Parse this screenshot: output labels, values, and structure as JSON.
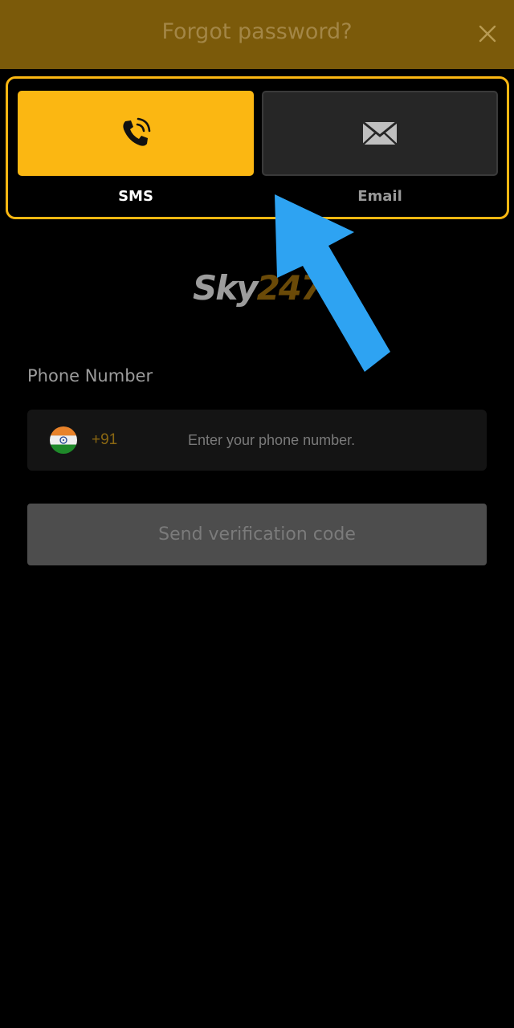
{
  "header": {
    "title": "Forgot password?",
    "close_icon": "close-icon"
  },
  "methods": [
    {
      "label": "SMS",
      "icon": "phone-icon",
      "selected": true
    },
    {
      "label": "Email",
      "icon": "envelope-icon",
      "selected": false
    }
  ],
  "logo": {
    "part1": "Sky",
    "part2": "247"
  },
  "phone": {
    "label": "Phone Number",
    "country_icon": "india-flag-icon",
    "dial_code": "+91",
    "placeholder": "Enter your phone number.",
    "value": ""
  },
  "submit": {
    "label": "Send verification code"
  },
  "colors": {
    "accent": "#fbb712",
    "header_bg": "#7b5a0a",
    "background": "#000000",
    "pointer_arrow": "#2ea3f2"
  }
}
